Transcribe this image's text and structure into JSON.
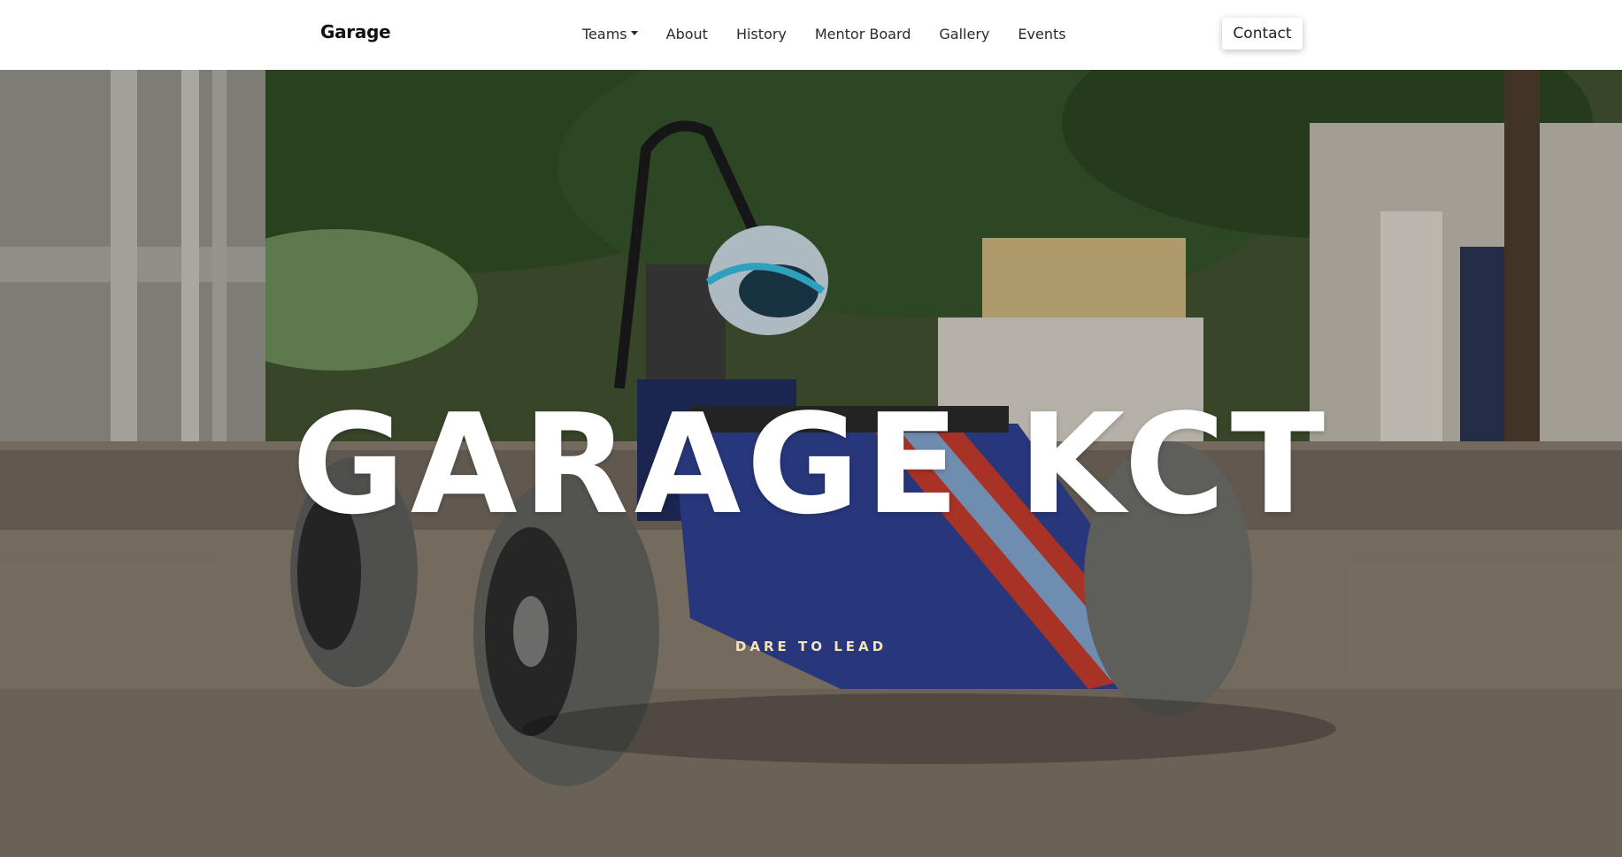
{
  "navbar": {
    "brand": "Garage",
    "links": [
      {
        "label": "Teams",
        "dropdown": true
      },
      {
        "label": "About"
      },
      {
        "label": "History"
      },
      {
        "label": "Mentor Board"
      },
      {
        "label": "Gallery"
      },
      {
        "label": "Events"
      }
    ],
    "contact_label": "Contact"
  },
  "hero": {
    "title": "GARAGE KCT",
    "subtitle": "DARE TO LEAD",
    "image": "race-car-photo"
  },
  "colors": {
    "navbar_bg": "#ffffff",
    "text_dark": "#222222",
    "hero_title": "#ffffff",
    "hero_subtitle": "#f3e2bd"
  }
}
